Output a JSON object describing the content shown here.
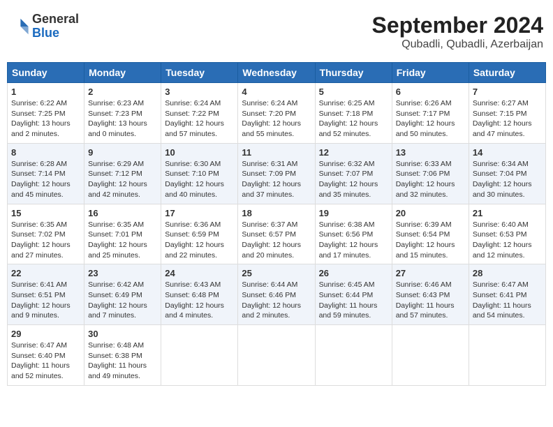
{
  "header": {
    "logo_general": "General",
    "logo_blue": "Blue",
    "month": "September 2024",
    "location": "Qubadli, Qubadli, Azerbaijan"
  },
  "days_of_week": [
    "Sunday",
    "Monday",
    "Tuesday",
    "Wednesday",
    "Thursday",
    "Friday",
    "Saturday"
  ],
  "weeks": [
    [
      {
        "day": "1",
        "sunrise": "6:22 AM",
        "sunset": "7:25 PM",
        "daylight": "13 hours and 2 minutes."
      },
      {
        "day": "2",
        "sunrise": "6:23 AM",
        "sunset": "7:23 PM",
        "daylight": "13 hours and 0 minutes."
      },
      {
        "day": "3",
        "sunrise": "6:24 AM",
        "sunset": "7:22 PM",
        "daylight": "12 hours and 57 minutes."
      },
      {
        "day": "4",
        "sunrise": "6:24 AM",
        "sunset": "7:20 PM",
        "daylight": "12 hours and 55 minutes."
      },
      {
        "day": "5",
        "sunrise": "6:25 AM",
        "sunset": "7:18 PM",
        "daylight": "12 hours and 52 minutes."
      },
      {
        "day": "6",
        "sunrise": "6:26 AM",
        "sunset": "7:17 PM",
        "daylight": "12 hours and 50 minutes."
      },
      {
        "day": "7",
        "sunrise": "6:27 AM",
        "sunset": "7:15 PM",
        "daylight": "12 hours and 47 minutes."
      }
    ],
    [
      {
        "day": "8",
        "sunrise": "6:28 AM",
        "sunset": "7:14 PM",
        "daylight": "12 hours and 45 minutes."
      },
      {
        "day": "9",
        "sunrise": "6:29 AM",
        "sunset": "7:12 PM",
        "daylight": "12 hours and 42 minutes."
      },
      {
        "day": "10",
        "sunrise": "6:30 AM",
        "sunset": "7:10 PM",
        "daylight": "12 hours and 40 minutes."
      },
      {
        "day": "11",
        "sunrise": "6:31 AM",
        "sunset": "7:09 PM",
        "daylight": "12 hours and 37 minutes."
      },
      {
        "day": "12",
        "sunrise": "6:32 AM",
        "sunset": "7:07 PM",
        "daylight": "12 hours and 35 minutes."
      },
      {
        "day": "13",
        "sunrise": "6:33 AM",
        "sunset": "7:06 PM",
        "daylight": "12 hours and 32 minutes."
      },
      {
        "day": "14",
        "sunrise": "6:34 AM",
        "sunset": "7:04 PM",
        "daylight": "12 hours and 30 minutes."
      }
    ],
    [
      {
        "day": "15",
        "sunrise": "6:35 AM",
        "sunset": "7:02 PM",
        "daylight": "12 hours and 27 minutes."
      },
      {
        "day": "16",
        "sunrise": "6:35 AM",
        "sunset": "7:01 PM",
        "daylight": "12 hours and 25 minutes."
      },
      {
        "day": "17",
        "sunrise": "6:36 AM",
        "sunset": "6:59 PM",
        "daylight": "12 hours and 22 minutes."
      },
      {
        "day": "18",
        "sunrise": "6:37 AM",
        "sunset": "6:57 PM",
        "daylight": "12 hours and 20 minutes."
      },
      {
        "day": "19",
        "sunrise": "6:38 AM",
        "sunset": "6:56 PM",
        "daylight": "12 hours and 17 minutes."
      },
      {
        "day": "20",
        "sunrise": "6:39 AM",
        "sunset": "6:54 PM",
        "daylight": "12 hours and 15 minutes."
      },
      {
        "day": "21",
        "sunrise": "6:40 AM",
        "sunset": "6:53 PM",
        "daylight": "12 hours and 12 minutes."
      }
    ],
    [
      {
        "day": "22",
        "sunrise": "6:41 AM",
        "sunset": "6:51 PM",
        "daylight": "12 hours and 9 minutes."
      },
      {
        "day": "23",
        "sunrise": "6:42 AM",
        "sunset": "6:49 PM",
        "daylight": "12 hours and 7 minutes."
      },
      {
        "day": "24",
        "sunrise": "6:43 AM",
        "sunset": "6:48 PM",
        "daylight": "12 hours and 4 minutes."
      },
      {
        "day": "25",
        "sunrise": "6:44 AM",
        "sunset": "6:46 PM",
        "daylight": "12 hours and 2 minutes."
      },
      {
        "day": "26",
        "sunrise": "6:45 AM",
        "sunset": "6:44 PM",
        "daylight": "11 hours and 59 minutes."
      },
      {
        "day": "27",
        "sunrise": "6:46 AM",
        "sunset": "6:43 PM",
        "daylight": "11 hours and 57 minutes."
      },
      {
        "day": "28",
        "sunrise": "6:47 AM",
        "sunset": "6:41 PM",
        "daylight": "11 hours and 54 minutes."
      }
    ],
    [
      {
        "day": "29",
        "sunrise": "6:47 AM",
        "sunset": "6:40 PM",
        "daylight": "11 hours and 52 minutes."
      },
      {
        "day": "30",
        "sunrise": "6:48 AM",
        "sunset": "6:38 PM",
        "daylight": "11 hours and 49 minutes."
      },
      null,
      null,
      null,
      null,
      null
    ]
  ]
}
